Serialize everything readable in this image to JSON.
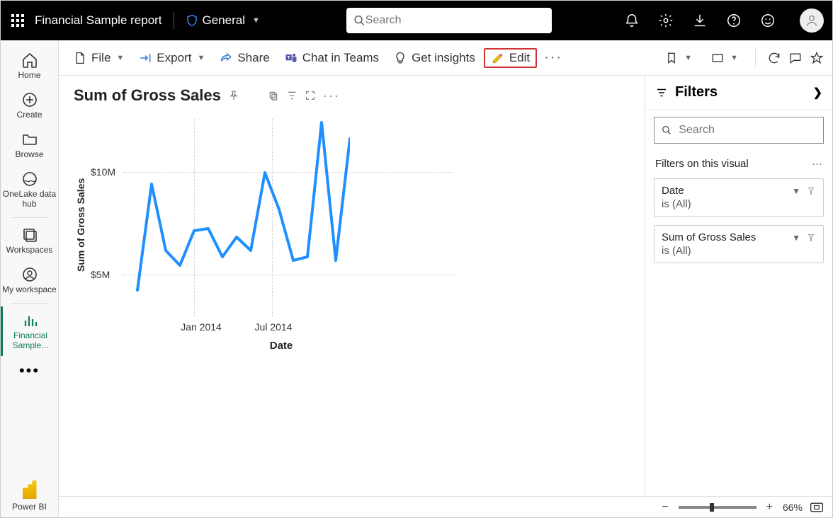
{
  "header": {
    "report_title": "Financial Sample report",
    "sensitivity_label": "General",
    "search_placeholder": "Search"
  },
  "leftnav": {
    "home": "Home",
    "create": "Create",
    "browse": "Browse",
    "onelake": "OneLake data hub",
    "workspaces": "Workspaces",
    "myworkspace": "My workspace",
    "active_report": "Financial Sample...",
    "footer": "Power BI"
  },
  "toolbar": {
    "file": "File",
    "export": "Export",
    "share": "Share",
    "chat": "Chat in Teams",
    "insights": "Get insights",
    "edit": "Edit"
  },
  "visual": {
    "title": "Sum of Gross Sales",
    "xaxis": "Date",
    "yaxis": "Sum of Gross Sales",
    "yticks": [
      "$10M",
      "$5M"
    ],
    "xticks": [
      "Jan 2014",
      "Jul 2014"
    ]
  },
  "filters": {
    "header": "Filters",
    "search_placeholder": "Search",
    "section": "Filters on this visual",
    "cards": [
      {
        "name": "Date",
        "value": "is (All)"
      },
      {
        "name": "Sum of Gross Sales",
        "value": "is (All)"
      }
    ]
  },
  "statusbar": {
    "zoom": "66%"
  },
  "chart_data": {
    "type": "line",
    "title": "Sum of Gross Sales",
    "xlabel": "Date",
    "ylabel": "Sum of Gross Sales",
    "ylim": [
      4,
      13
    ],
    "y_unit": "$M",
    "x": [
      "Sep 2013",
      "Oct 2013",
      "Nov 2013",
      "Dec 2013",
      "Jan 2014",
      "Feb 2014",
      "Mar 2014",
      "Apr 2014",
      "May 2014",
      "Jun 2014",
      "Jul 2014",
      "Aug 2014",
      "Sep 2014",
      "Oct 2014",
      "Nov 2014",
      "Dec 2014"
    ],
    "values": [
      4.6,
      9.8,
      6.5,
      5.8,
      7.5,
      7.6,
      6.2,
      7.2,
      6.5,
      10.3,
      8.5,
      6.0,
      6.2,
      12.8,
      6.0,
      12.0
    ]
  }
}
